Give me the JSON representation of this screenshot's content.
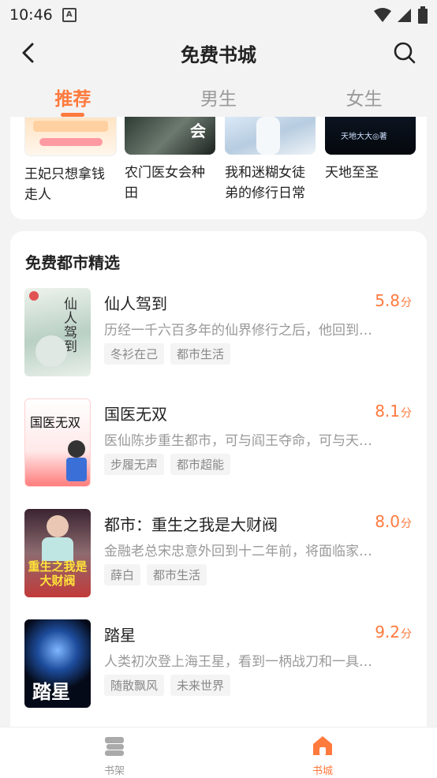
{
  "status_bar": {
    "time": "10:46"
  },
  "header": {
    "title": "免费书城"
  },
  "tabs": [
    {
      "label": "推荐",
      "active": true
    },
    {
      "label": "男生",
      "active": false
    },
    {
      "label": "女生",
      "active": false
    }
  ],
  "grid_books": [
    {
      "title": "王妃只想拿钱走人",
      "cover_text": ""
    },
    {
      "title": "农门医女会种田",
      "cover_text": "会"
    },
    {
      "title": "我和迷糊女徒弟的修行日常",
      "cover_text": ""
    },
    {
      "title": "天地至圣",
      "cover_text": "天地大大◎著"
    }
  ],
  "section": {
    "title": "免费都市精选",
    "books": [
      {
        "title": "仙人驾到",
        "score": "5.8",
        "score_unit": "分",
        "desc": "历经一千六百多年的仙界修行之后，他回到…",
        "tags": [
          "冬衫在己",
          "都市生活"
        ],
        "cover_text": "仙人驾到"
      },
      {
        "title": "国医无双",
        "score": "8.1",
        "score_unit": "分",
        "desc": "医仙陈步重生都市，可与阎王夺命，可与天…",
        "tags": [
          "步履无声",
          "都市超能"
        ],
        "cover_text": "国医无双"
      },
      {
        "title": "都市：重生之我是大财阀",
        "score": "8.0",
        "score_unit": "分",
        "desc": "金融老总宋忠意外回到十二年前，将面临家…",
        "tags": [
          "薛白",
          "都市生活"
        ],
        "cover_text": "重生之我是大财阀"
      },
      {
        "title": "踏星",
        "score": "9.2",
        "score_unit": "分",
        "desc": "人类初次登上海王星，看到一柄战刀和一具…",
        "tags": [
          "随散飘风",
          "未来世界"
        ],
        "cover_text": "踏星"
      }
    ]
  },
  "bottom_nav": [
    {
      "label": "书架",
      "active": false,
      "icon": "bookshelf-icon"
    },
    {
      "label": "书城",
      "active": true,
      "icon": "home-icon"
    }
  ],
  "colors": {
    "accent": "#ff7a3d",
    "background": "#f3f3f3"
  }
}
